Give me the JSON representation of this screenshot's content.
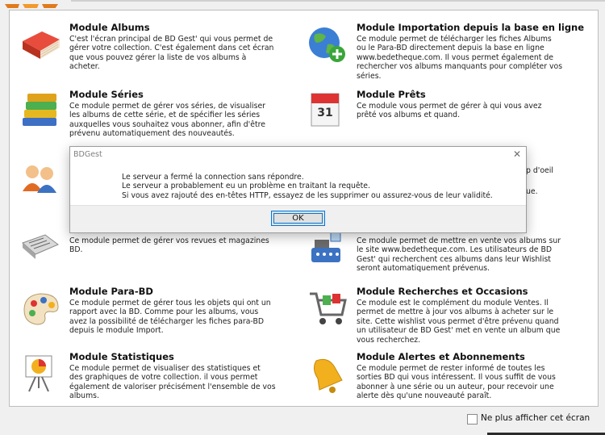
{
  "modules": [
    {
      "title": "Module Albums",
      "desc": "C'est l'écran principal de BD Gest' qui vous permet de gérer votre collection. C'est également dans cet écran que vous pouvez gérer la liste de vos albums à acheter.",
      "icon": "book-icon"
    },
    {
      "title": "Module Importation depuis la base en ligne",
      "desc": "Ce module permet de télécharger les fiches Albums ou le Para-BD directement depuis la base en ligne www.bedetheque.com. Il vous permet également de rechercher vos albums manquants pour compléter vos séries.",
      "icon": "globe-add-icon"
    },
    {
      "title": "Module Séries",
      "desc": "Ce module permet de gérer vos séries, de visualiser les albums de cette série, et de spécifier les séries auxquelles vous souhaitez vous abonner, afin d'être prévenu automatiquement des nouveautés.",
      "icon": "books-stack-icon"
    },
    {
      "title": "Module Prêts",
      "desc": "Ce module vous permet de gérer à qui vous avez prêté vos albums et quand.",
      "icon": "calendar-icon"
    },
    {
      "title": "",
      "desc": "Ce module permet de gérer vos revues et magazines BD.",
      "icon": "magazine-icon"
    },
    {
      "title": "",
      "desc": "Ce module permet de mettre en vente vos albums sur le site www.bedetheque.com. Les utilisateurs de BD Gest' qui recherchent ces albums dans leur Wishlist seront automatiquement prévenus.",
      "icon": "cash-register-icon"
    },
    {
      "title": "Module Para-BD",
      "desc": "Ce module permet de gérer tous les objets qui ont un rapport avec la BD. Comme pour les albums, vous avez la possibilité de télécharger les fiches para-BD depuis le module Import.",
      "icon": "palette-icon"
    },
    {
      "title": "Module Recherches et Occasions",
      "desc": "Ce module est le complément du module Ventes. Il permet de mettre à jour vos albums à acheter sur le site. Cette wishlist vous permet d'être prévenu quand un utilisateur de BD Gest' met en vente un album que vous recherchez.",
      "icon": "shopping-cart-icon"
    },
    {
      "title": "Module Statistiques",
      "desc": "Ce module permet de visualiser des statistiques et des graphiques de votre collection. il vous permet également de valoriser précisément l'ensemble de vos albums.",
      "icon": "chart-easel-icon"
    },
    {
      "title": "Module Alertes et Abonnements",
      "desc": "Ce module permet de rester informé de toutes les sorties BD qui vous intéressent. Il vous suffit de vous abonner à une série ou un auteur, pour recevoir une alerte dès qu'une nouveauté paraît.",
      "icon": "bell-icon"
    }
  ],
  "hidden_fragments": {
    "fragment_1": "p d'oeil",
    "fragment_2": "ue."
  },
  "dialog": {
    "title": "BDGest",
    "close": "✕",
    "message_line_1": "Le serveur a fermé la connection sans répondre.",
    "message_line_2": "Le serveur a probablement eu un problème en traitant la requête.",
    "message_line_3": "Si vous avez rajouté des en-têtes HTTP, essayez de les supprimer ou assurez-vous de leur validité.",
    "ok_label": "OK"
  },
  "footer": {
    "checkbox_label": "Ne plus afficher cet écran",
    "checked": false
  },
  "colors": {
    "accent": "#0078d7",
    "panel_bg": "#ffffff",
    "window_bg": "#f0f0f0"
  }
}
